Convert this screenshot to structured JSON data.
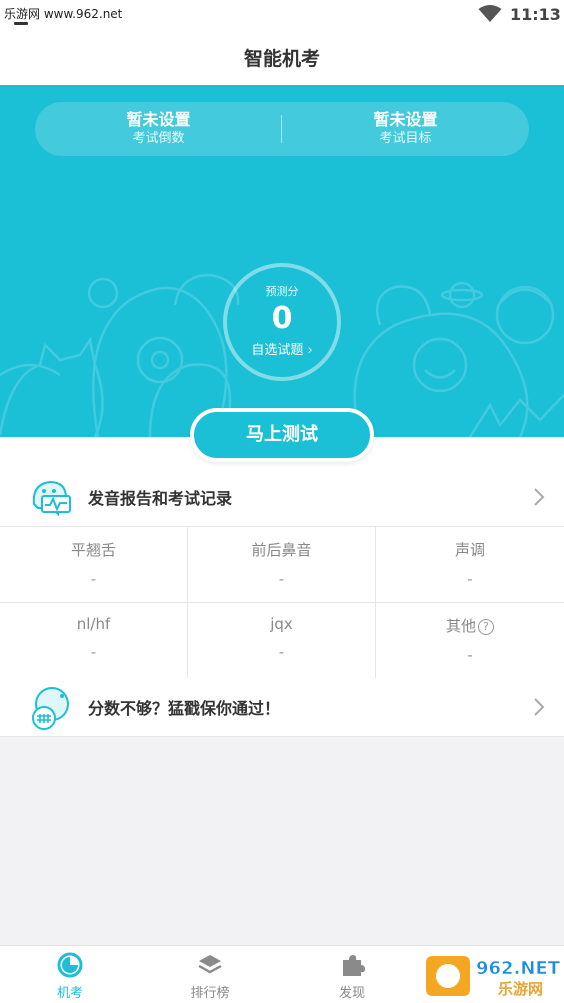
{
  "status_bar": {
    "watermark": "乐游网 www.962.net",
    "time": "11:13"
  },
  "header": {
    "title": "智能机考"
  },
  "goals": [
    {
      "value": "暂未设置",
      "label": "考试倒数"
    },
    {
      "value": "暂未设置",
      "label": "考试目标"
    }
  ],
  "score": {
    "label": "预测分",
    "value": "0",
    "link": "自选试题"
  },
  "actions": {
    "test_now": "马上测试"
  },
  "report": {
    "title": "发音报告和考试记录"
  },
  "stats": [
    {
      "label": "平翘舌",
      "value": "-"
    },
    {
      "label": "前后鼻音",
      "value": "-"
    },
    {
      "label": "声调",
      "value": "-"
    },
    {
      "label": "nl/hf",
      "value": "-"
    },
    {
      "label": "jqx",
      "value": "-"
    },
    {
      "label": "其他",
      "value": "-"
    }
  ],
  "promo": {
    "title": "分数不够？猛戳保你通过！"
  },
  "tabs": [
    {
      "label": "机考",
      "icon": "clock-icon",
      "active": true
    },
    {
      "label": "排行榜",
      "icon": "layers-icon",
      "active": false
    },
    {
      "label": "发现",
      "icon": "puzzle-icon",
      "active": false
    }
  ],
  "watermark_badge": {
    "top": "962.NET",
    "bottom": "乐游网"
  },
  "colors": {
    "accent": "#1bbfd6",
    "text": "#333333",
    "muted": "#888888"
  }
}
